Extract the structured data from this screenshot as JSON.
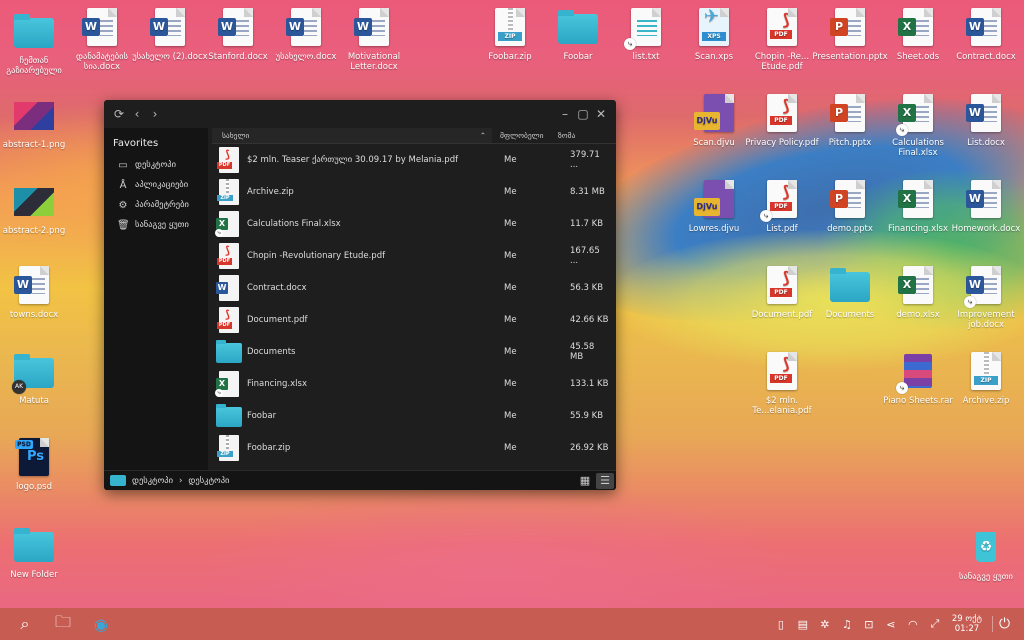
{
  "desktop_icons": [
    {
      "label": "ჩემთან გაზიარებული",
      "type": "folder"
    },
    {
      "label": "დანამატების სია.docx",
      "type": "word"
    },
    {
      "label": "უსახელო (2).docx",
      "type": "word"
    },
    {
      "label": "Stanford.docx",
      "type": "word"
    },
    {
      "label": "უსახელო.docx",
      "type": "word"
    },
    {
      "label": "Motivational Letter.docx",
      "type": "word"
    },
    {
      "label": "Foobar.zip",
      "type": "zip"
    },
    {
      "label": "Foobar",
      "type": "folder"
    },
    {
      "label": "list.txt",
      "type": "txt"
    },
    {
      "label": "Scan.xps",
      "type": "xps"
    },
    {
      "label": "Chopin -Re... Etude.pdf",
      "type": "pdf"
    },
    {
      "label": "Presentation.pptx",
      "type": "ppt"
    },
    {
      "label": "Sheet.ods",
      "type": "excel"
    },
    {
      "label": "Contract.docx",
      "type": "word"
    },
    {
      "label": "abstract-1.png",
      "type": "image"
    },
    {
      "label": "Scan.djvu",
      "type": "djvu"
    },
    {
      "label": "Privacy Policy.pdf",
      "type": "pdf"
    },
    {
      "label": "Pitch.pptx",
      "type": "ppt"
    },
    {
      "label": "Calculations Final.xlsx",
      "type": "excel"
    },
    {
      "label": "List.docx",
      "type": "word"
    },
    {
      "label": "abstract-2.png",
      "type": "image"
    },
    {
      "label": "Lowres.djvu",
      "type": "djvu"
    },
    {
      "label": "List.pdf",
      "type": "pdf"
    },
    {
      "label": "demo.pptx",
      "type": "ppt"
    },
    {
      "label": "Financing.xlsx",
      "type": "excel"
    },
    {
      "label": "Homework.docx",
      "type": "word"
    },
    {
      "label": "towns.docx",
      "type": "word"
    },
    {
      "label": "Document.pdf",
      "type": "pdf"
    },
    {
      "label": "Documents",
      "type": "folder"
    },
    {
      "label": "demo.xlsx",
      "type": "excel"
    },
    {
      "label": "Improvement job.docx",
      "type": "word"
    },
    {
      "label": "Matuta",
      "type": "folder"
    },
    {
      "label": "$2 mln. Te...elania.pdf",
      "type": "pdf"
    },
    {
      "label": "Piano Sheets.rar",
      "type": "rar"
    },
    {
      "label": "Archive.zip",
      "type": "zip"
    },
    {
      "label": "logo.psd",
      "type": "psd"
    },
    {
      "label": "New Folder",
      "type": "folder"
    },
    {
      "label": "სანაგვე ყუთი",
      "type": "trash"
    }
  ],
  "icon_text": {
    "w": "W",
    "x": "X",
    "p": "P",
    "pdf": "PDF",
    "zip": "ZIP",
    "xps": "XPS",
    "djvu": "DjVu",
    "psd": "PSD",
    "ps": "Ps",
    "ak": "AK"
  },
  "window": {
    "title": "",
    "sidebar": {
      "heading": "Favorites",
      "items": [
        {
          "label": "დესკტოპი",
          "icon": "monitor-icon"
        },
        {
          "label": "აპლიკაციები",
          "icon": "apps-icon"
        },
        {
          "label": "პარამეტრები",
          "icon": "gear-icon"
        },
        {
          "label": "სანაგვე ყუთი",
          "icon": "trash-icon"
        }
      ]
    },
    "columns": {
      "name": "სახელი",
      "owner": "მფლობელი",
      "size": "ზომა"
    },
    "files": [
      {
        "name": "$2 mln. Teaser ქართული 30.09.17 by Melania.pdf",
        "owner": "Me",
        "size": "379.71 ...",
        "type": "pdf"
      },
      {
        "name": "Archive.zip",
        "owner": "Me",
        "size": "8.31 MB",
        "type": "zip"
      },
      {
        "name": "Calculations Final.xlsx",
        "owner": "Me",
        "size": "11.7 KB",
        "type": "excel"
      },
      {
        "name": "Chopin -Revolutionary Etude.pdf",
        "owner": "Me",
        "size": "167.65 ...",
        "type": "pdf"
      },
      {
        "name": "Contract.docx",
        "owner": "Me",
        "size": "56.3 KB",
        "type": "word"
      },
      {
        "name": "Document.pdf",
        "owner": "Me",
        "size": "42.66 KB",
        "type": "pdf"
      },
      {
        "name": "Documents",
        "owner": "Me",
        "size": "45.58 MB",
        "type": "folder"
      },
      {
        "name": "Financing.xlsx",
        "owner": "Me",
        "size": "133.1 KB",
        "type": "excel"
      },
      {
        "name": "Foobar",
        "owner": "Me",
        "size": "55.9 KB",
        "type": "folder"
      },
      {
        "name": "Foobar.zip",
        "owner": "Me",
        "size": "26.92 KB",
        "type": "zip"
      }
    ],
    "path": [
      "დესკტოპი",
      "დესკტოპი"
    ],
    "path_separator": "›"
  },
  "taskbar": {
    "date": "29 ოქტ",
    "time": "01:27"
  }
}
